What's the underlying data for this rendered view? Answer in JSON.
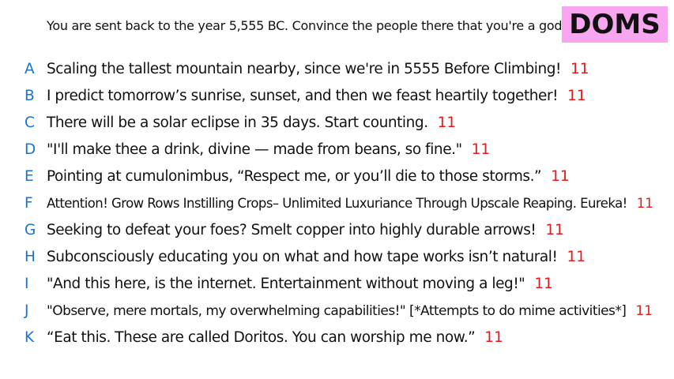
{
  "prompt": "You are sent back to the year 5,555 BC. Convince the people there that you're a god.",
  "tag": "DOMS",
  "colors": {
    "letter": "#1a73d1",
    "score": "#e01b1b",
    "tag_background": "#f7a6ef"
  },
  "entries": [
    {
      "letter": "A",
      "text": "Scaling the tallest mountain nearby, since we're in 5555 Before Climbing!",
      "score": "11"
    },
    {
      "letter": "B",
      "text": "I predict tomorrow’s sunrise, sunset, and then we feast heartily together!",
      "score": "11"
    },
    {
      "letter": "C",
      "text": "There will be a solar eclipse in 35 days. Start counting.",
      "score": "11"
    },
    {
      "letter": "D",
      "text": "\"I'll make thee a drink, divine — made from beans, so fine.\"",
      "score": "11"
    },
    {
      "letter": "E",
      "text": "Pointing at cumulonimbus, “Respect me, or you’ll die to those storms.”",
      "score": "11"
    },
    {
      "letter": "F",
      "text": "Attention! Grow Rows Instilling Crops– Unlimited Luxuriance Through Upscale Reaping. Eureka!",
      "score": "11"
    },
    {
      "letter": "G",
      "text": "Seeking to defeat your foes? Smelt copper into highly durable arrows!",
      "score": "11"
    },
    {
      "letter": "H",
      "text": "Subconsciously educating you on what and how tape works isn’t natural!",
      "score": "11"
    },
    {
      "letter": "I",
      "text": "\"And this here, is the internet. Entertainment without moving a leg!\"",
      "score": "11"
    },
    {
      "letter": "J",
      "text": "\"Observe, mere mortals, my overwhelming capabilities!\" [*Attempts to do mime activities*]",
      "score": "11"
    },
    {
      "letter": "K",
      "text": "“Eat this. These are called Doritos. You can worship me now.”",
      "score": "11"
    }
  ]
}
